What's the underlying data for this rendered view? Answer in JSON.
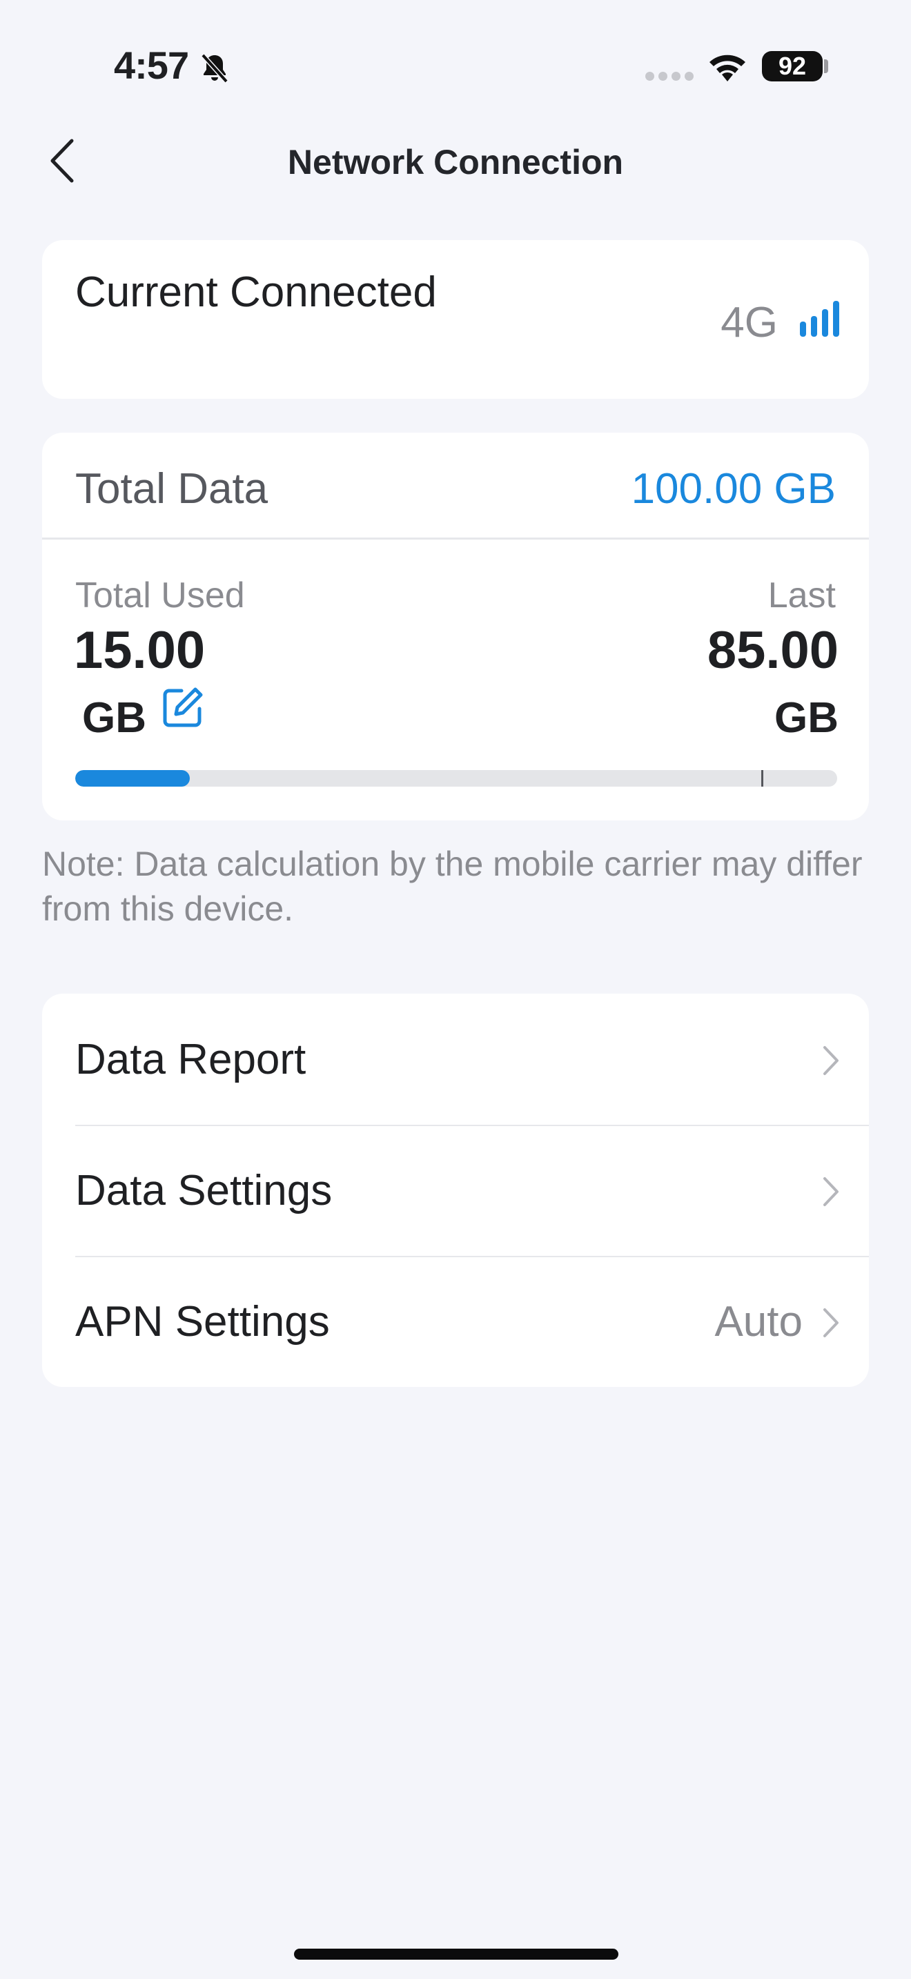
{
  "status_bar": {
    "time": "4:57",
    "battery": "92"
  },
  "nav": {
    "title": "Network Connection"
  },
  "connection": {
    "label": "Current Connected",
    "type": "4G"
  },
  "data_usage": {
    "total_label": "Total Data",
    "total_value": "100.00 GB",
    "used_label": "Total Used",
    "used_value": "15.00",
    "used_unit": "GB",
    "last_label": "Last",
    "last_value": "85.00",
    "last_unit": "GB",
    "used_fraction": 0.15,
    "marker_fraction": 0.9
  },
  "note": "Note: Data calculation by the mobile carrier may differ from this device.",
  "menu": {
    "items": [
      {
        "label": "Data Report",
        "value": ""
      },
      {
        "label": "Data Settings",
        "value": ""
      },
      {
        "label": "APN Settings",
        "value": "Auto"
      }
    ]
  },
  "colors": {
    "accent": "#1a88dd",
    "background": "#f4f5fa",
    "card": "#ffffff",
    "muted_text": "#8a8b90"
  },
  "icons": {
    "back": "chevron-left-icon",
    "silent": "bell-slash-icon",
    "wifi": "wifi-icon",
    "signal": "signal-bars-icon",
    "edit": "edit-icon",
    "chevron": "chevron-right-icon"
  }
}
